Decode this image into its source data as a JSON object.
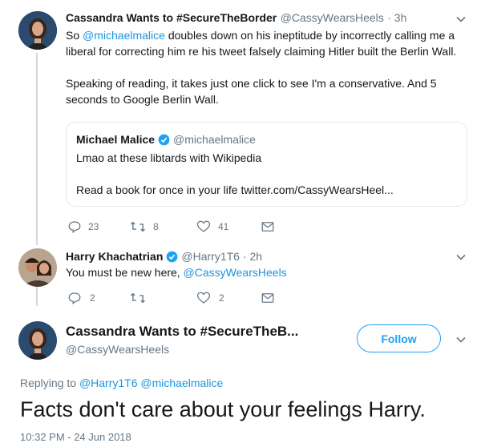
{
  "tweet1": {
    "name": "Cassandra Wants to #SecureTheBorder",
    "handle": "@CassyWearsHeels",
    "time": "· 3h",
    "text_pre": "So ",
    "mention": "@michaelmalice",
    "text_post": " doubles down on his ineptitude by incorrectly calling me a liberal for correcting him re his tweet falsely claiming Hitler built the Berlin Wall.",
    "text2": "Speaking of reading, it takes just one click to see I'm a conservative. And 5 seconds to Google Berlin Wall.",
    "quote": {
      "name": "Michael Malice",
      "handle": "@michaelmalice",
      "line1": "Lmao at these libtards with Wikipedia",
      "line2": "Read a book for once in your life twitter.com/CassyWearsHeel..."
    },
    "replies": "23",
    "retweets": "8",
    "likes": "41"
  },
  "tweet2": {
    "name": "Harry Khachatrian",
    "handle": "@Harry1T6",
    "time": "· 2h",
    "text_pre": "You must be new here, ",
    "mention": "@CassyWearsHeels",
    "replies": "2",
    "retweets": "",
    "likes": "2"
  },
  "tweet3": {
    "name": "Cassandra Wants to #SecureTheB...",
    "handle": "@CassyWearsHeels",
    "follow_label": "Follow",
    "replying_to": "Replying to",
    "replying_handles": "@Harry1T6 @michaelmalice",
    "text": "Facts don't care about your feelings Harry.",
    "footer": "10:32 PM - 24 Jun 2018"
  },
  "colors": {
    "accent": "#1da1f2",
    "link": "#1b95e0",
    "muted": "#657786",
    "verified": "#1da1f2"
  }
}
